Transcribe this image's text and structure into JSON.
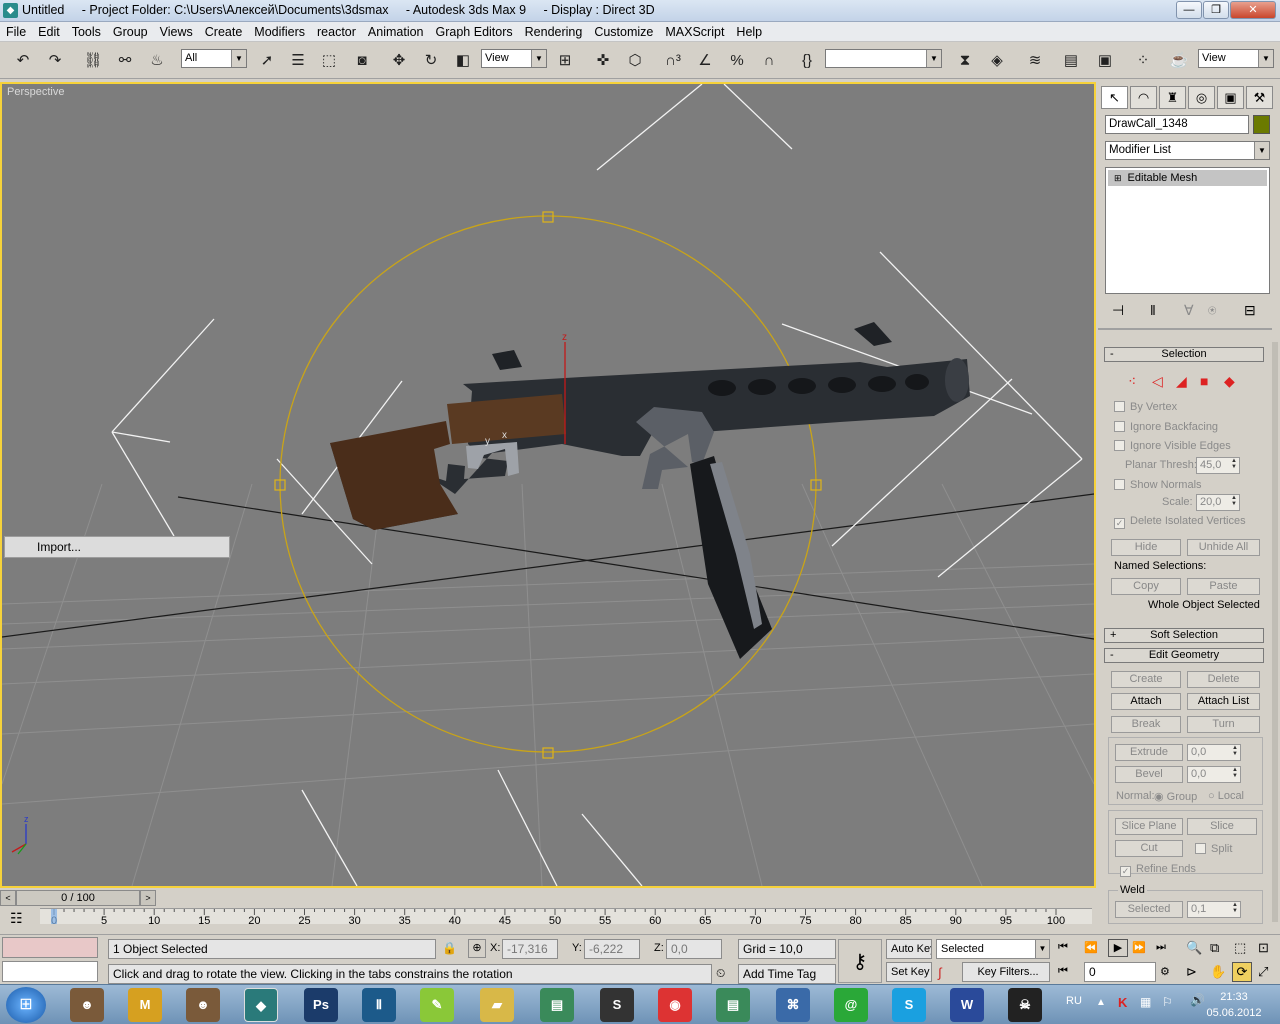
{
  "window": {
    "title": "Untitled     - Project Folder: C:\\Users\\Алексей\\Documents\\3dsmax     - Autodesk 3ds Max 9     - Display : Direct 3D",
    "minimize": "—",
    "restore": "❐",
    "close": "✕"
  },
  "menu": [
    "File",
    "Edit",
    "Tools",
    "Group",
    "Views",
    "Create",
    "Modifiers",
    "reactor",
    "Animation",
    "Graph Editors",
    "Rendering",
    "Customize",
    "MAXScript",
    "Help"
  ],
  "toolbar": {
    "filter": "All",
    "refcoord": "View",
    "namedsel": "",
    "view2": "View"
  },
  "viewport": {
    "label": "Perspective",
    "context_menu_item": "Import...",
    "axis_z": "z",
    "axis_x": "x",
    "axis_y": "y"
  },
  "panel": {
    "object_name": "DrawCall_1348",
    "object_color": "#6b7a00",
    "modifier_list": "Modifier List",
    "stack_item": "Editable Mesh",
    "selection": {
      "title": "Selection",
      "by_vertex": "By Vertex",
      "ignore_backfacing": "Ignore Backfacing",
      "ignore_visible_edges": "Ignore Visible Edges",
      "planar_thresh_label": "Planar Thresh:",
      "planar_thresh": "45,0",
      "show_normals": "Show Normals",
      "scale_label": "Scale:",
      "scale": "20,0",
      "delete_isolated": "Delete Isolated Vertices",
      "hide": "Hide",
      "unhide_all": "Unhide All",
      "named_selections": "Named Selections:",
      "copy": "Copy",
      "paste": "Paste",
      "status": "Whole Object Selected"
    },
    "soft_selection": "Soft Selection",
    "edit_geometry": {
      "title": "Edit Geometry",
      "create": "Create",
      "delete": "Delete",
      "attach": "Attach",
      "attach_list": "Attach List",
      "break": "Break",
      "turn": "Turn",
      "extrude": "Extrude",
      "extrude_val": "0,0",
      "bevel": "Bevel",
      "bevel_val": "0,0",
      "normal_label": "Normal:",
      "group": "Group",
      "local": "Local",
      "slice_plane": "Slice Plane",
      "slice": "Slice",
      "cut": "Cut",
      "split": "Split",
      "refine_ends": "Refine Ends",
      "weld": "Weld",
      "selected": "Selected",
      "weld_val": "0,1"
    }
  },
  "timeline": {
    "frame": "0 / 100",
    "ticks": [
      "0",
      "5",
      "10",
      "15",
      "20",
      "25",
      "30",
      "35",
      "40",
      "45",
      "50",
      "55",
      "60",
      "65",
      "70",
      "75",
      "80",
      "85",
      "90",
      "95",
      "100"
    ]
  },
  "status": {
    "selected": "1 Object Selected",
    "prompt": "Click and drag to rotate the view.  Clicking in the tabs constrains the rotation",
    "x_label": "X:",
    "x": "-17,316",
    "y_label": "Y:",
    "y": "-6,222",
    "z_label": "Z:",
    "z": "0,0",
    "grid": "Grid = 10,0",
    "add_time_tag": "Add Time Tag",
    "auto_key": "Auto Key",
    "set_key": "Set Key",
    "key_mode": "Selected",
    "key_filters": "Key Filters...",
    "frame_field": "0"
  },
  "taskbar": {
    "lang": "RU",
    "time": "21:33",
    "date": "05.06.2012"
  }
}
